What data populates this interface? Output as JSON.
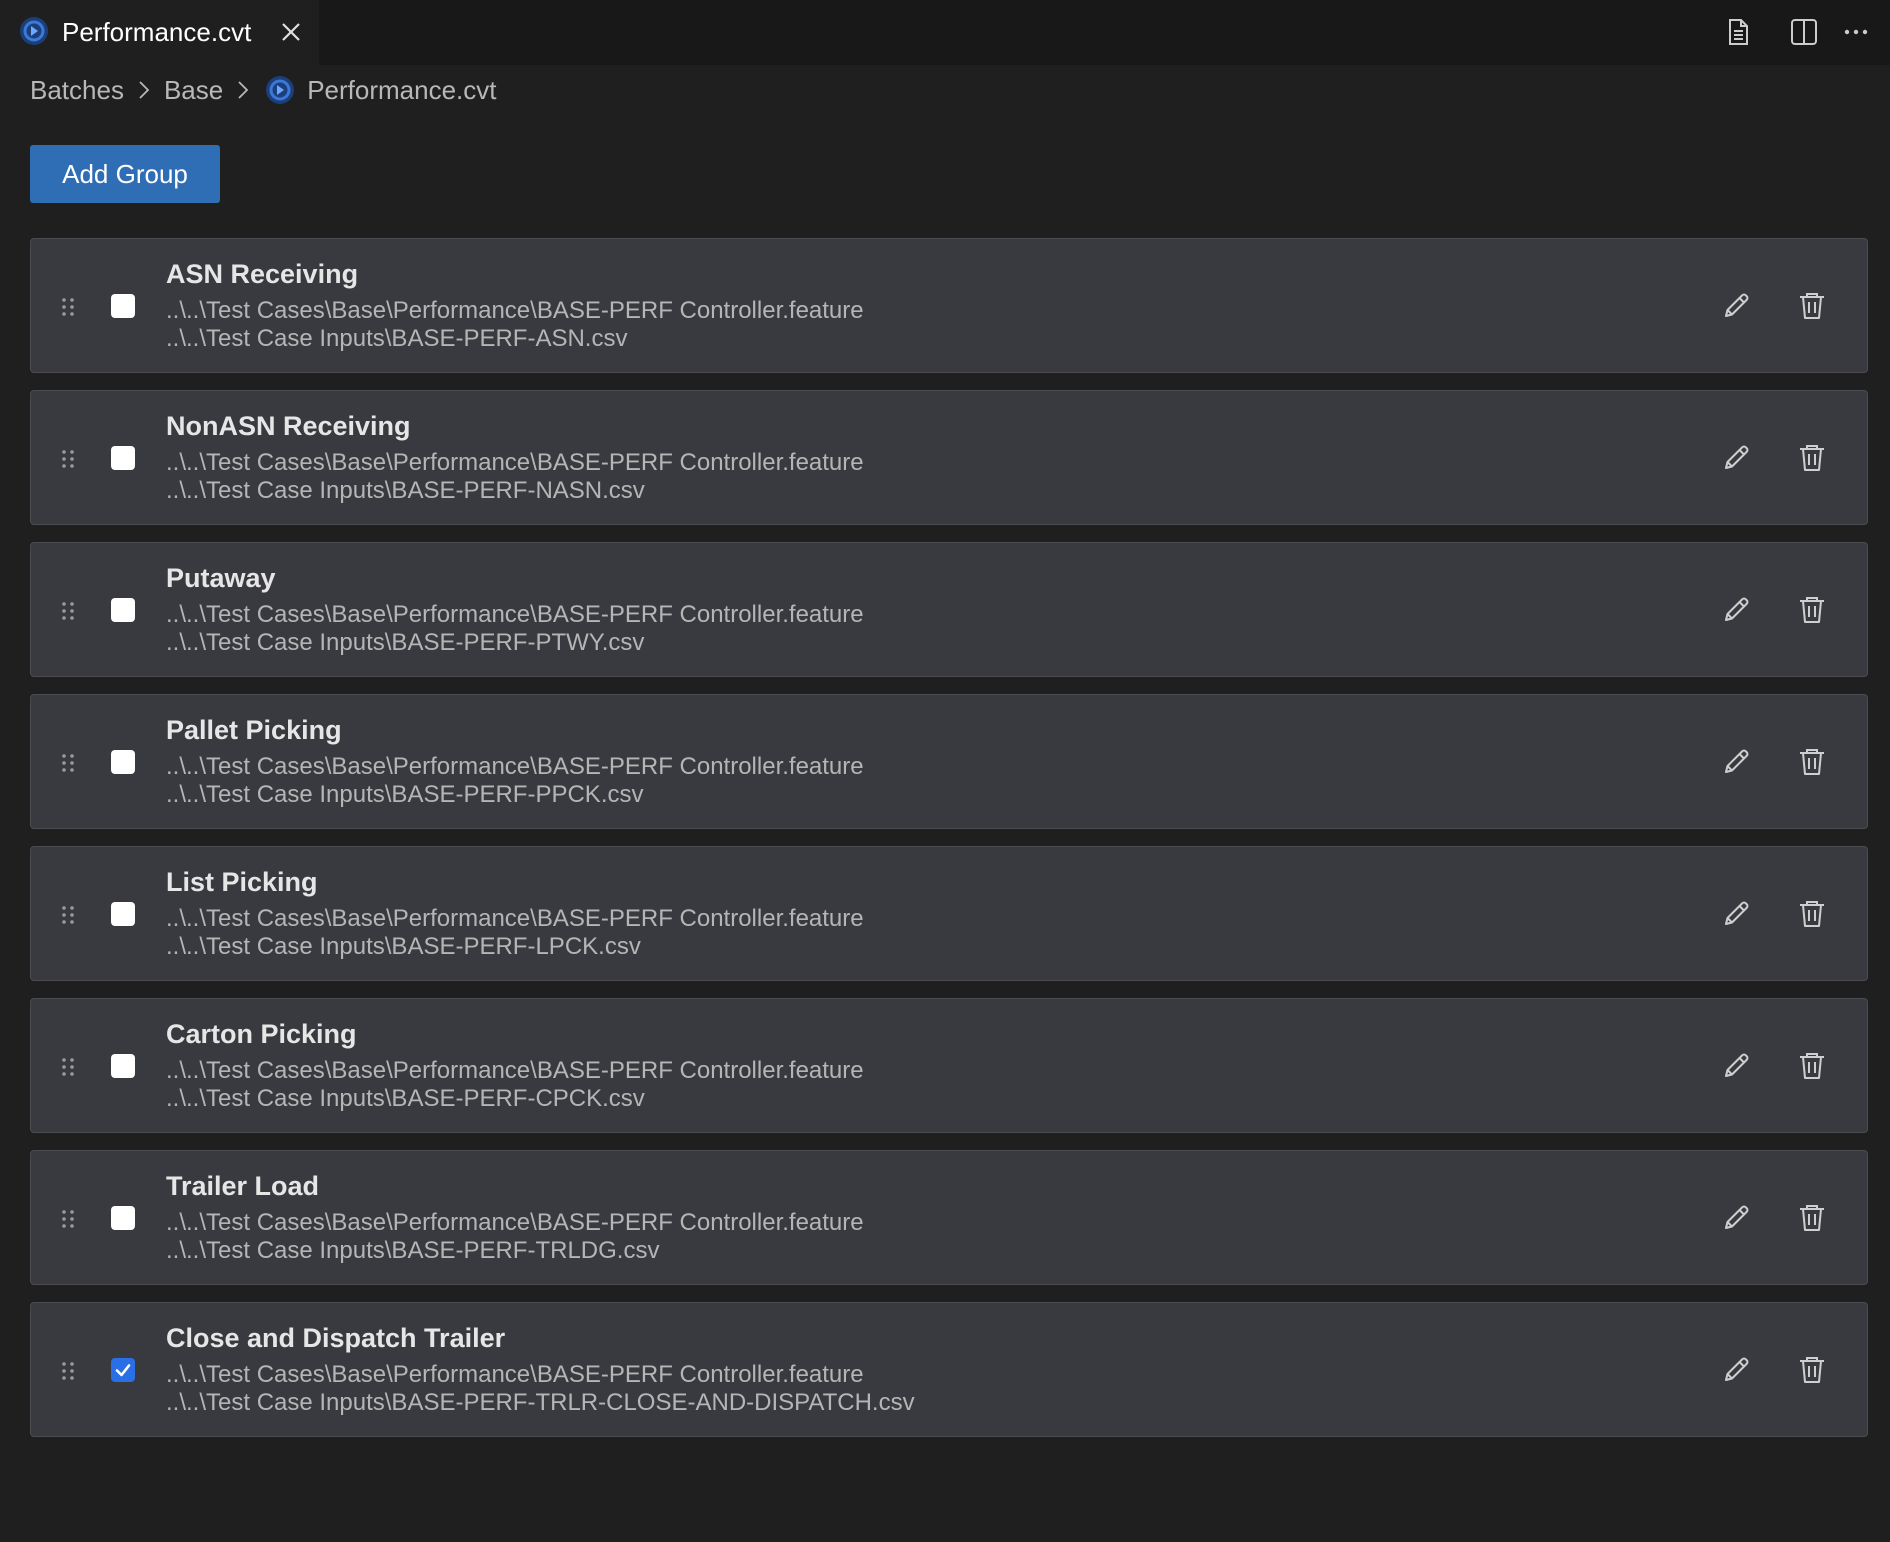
{
  "tab": {
    "title": "Performance.cvt",
    "logo_icon": "cvt-file-icon",
    "close_icon": "close-icon"
  },
  "toolbar": {
    "icons": [
      "open-preview-icon",
      "split-editor-icon",
      "more-actions-icon"
    ]
  },
  "breadcrumb": {
    "items": [
      "Batches",
      "Base",
      "Performance.cvt"
    ]
  },
  "add_group_label": "Add Group",
  "colors": {
    "background": "#1f1f1f",
    "tabbar": "#181818",
    "row_bg": "#393a3f",
    "button": "#2f6db5",
    "checkbox_checked": "#2a6fe6"
  },
  "groups": [
    {
      "name": "ASN Receiving",
      "feature": "..\\..\\Test Cases\\Base\\Performance\\BASE-PERF Controller.feature",
      "input": "..\\..\\Test Case Inputs\\BASE-PERF-ASN.csv",
      "checked": false
    },
    {
      "name": "NonASN Receiving",
      "feature": "..\\..\\Test Cases\\Base\\Performance\\BASE-PERF Controller.feature",
      "input": "..\\..\\Test Case Inputs\\BASE-PERF-NASN.csv",
      "checked": false
    },
    {
      "name": "Putaway",
      "feature": "..\\..\\Test Cases\\Base\\Performance\\BASE-PERF Controller.feature",
      "input": "..\\..\\Test Case Inputs\\BASE-PERF-PTWY.csv",
      "checked": false
    },
    {
      "name": "Pallet Picking",
      "feature": "..\\..\\Test Cases\\Base\\Performance\\BASE-PERF Controller.feature",
      "input": "..\\..\\Test Case Inputs\\BASE-PERF-PPCK.csv",
      "checked": false
    },
    {
      "name": "List Picking",
      "feature": "..\\..\\Test Cases\\Base\\Performance\\BASE-PERF Controller.feature",
      "input": "..\\..\\Test Case Inputs\\BASE-PERF-LPCK.csv",
      "checked": false
    },
    {
      "name": "Carton Picking",
      "feature": "..\\..\\Test Cases\\Base\\Performance\\BASE-PERF Controller.feature",
      "input": "..\\..\\Test Case Inputs\\BASE-PERF-CPCK.csv",
      "checked": false
    },
    {
      "name": "Trailer Load",
      "feature": "..\\..\\Test Cases\\Base\\Performance\\BASE-PERF Controller.feature",
      "input": "..\\..\\Test Case Inputs\\BASE-PERF-TRLDG.csv",
      "checked": false
    },
    {
      "name": "Close and Dispatch Trailer",
      "feature": "..\\..\\Test Cases\\Base\\Performance\\BASE-PERF Controller.feature",
      "input": "..\\..\\Test Case Inputs\\BASE-PERF-TRLR-CLOSE-AND-DISPATCH.csv",
      "checked": true
    }
  ]
}
